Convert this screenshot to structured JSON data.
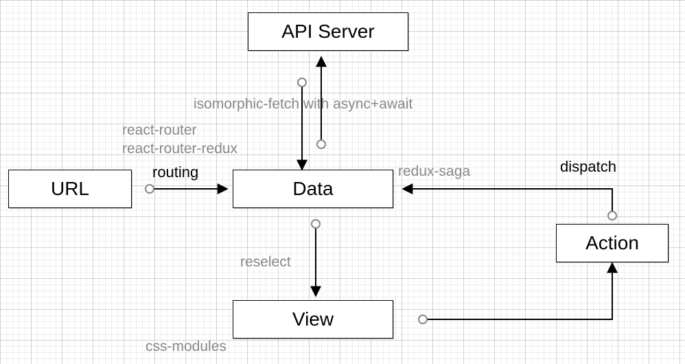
{
  "nodes": {
    "api_server": "API Server",
    "url": "URL",
    "data": "Data",
    "view": "View",
    "action": "Action"
  },
  "labels": {
    "routing": "routing",
    "react_router": "react-router",
    "react_router_redux": "react-router-redux",
    "iso_fetch": "isomorphic-fetch with async+await",
    "redux_saga": "redux-saga",
    "dispatch": "dispatch",
    "reselect": "reselect",
    "css_modules": "css-modules"
  }
}
